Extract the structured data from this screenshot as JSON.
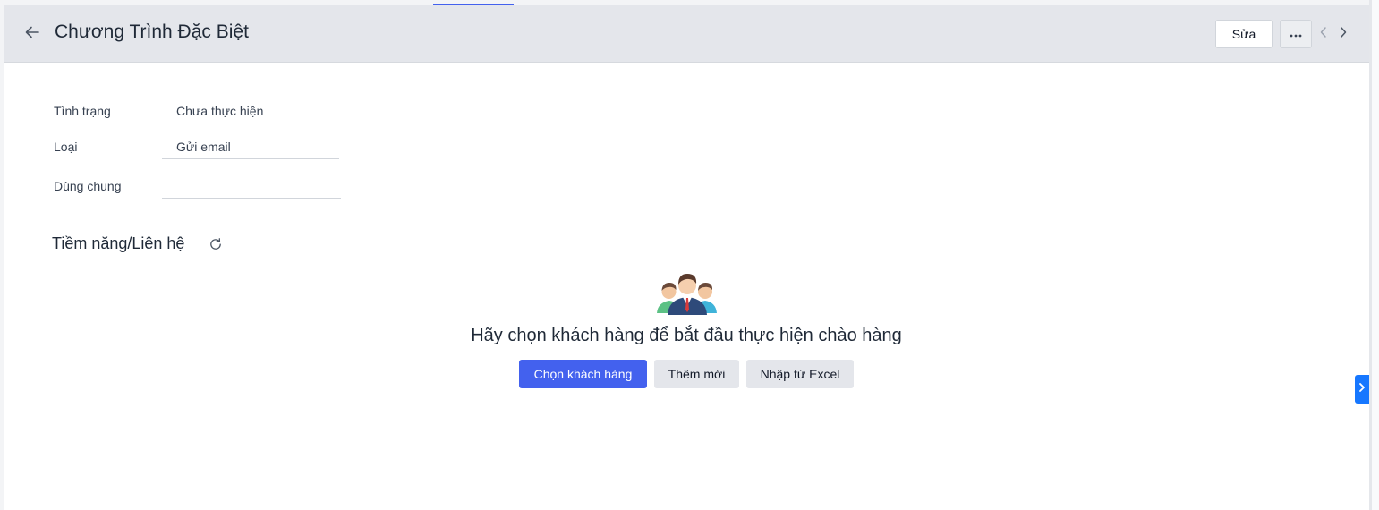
{
  "header": {
    "title": "Chương Trình Đặc Biệt",
    "edit_label": "Sửa",
    "back_icon": "arrow-left-icon",
    "more_icon": "ellipsis-icon",
    "prev_icon": "chevron-left-icon",
    "next_icon": "chevron-right-icon"
  },
  "fields": [
    {
      "label": "Tình trạng",
      "value": "Chưa thực hiện"
    },
    {
      "label": "Loại",
      "value": "Gửi email"
    },
    {
      "label": "Dùng chung",
      "value": ""
    }
  ],
  "section": {
    "title": "Tiềm năng/Liên hệ",
    "refresh_icon": "refresh-icon"
  },
  "empty_state": {
    "illustration": "people-group-icon",
    "message": "Hãy chọn khách hàng để bắt đầu thực hiện chào hàng",
    "buttons": {
      "primary": "Chọn khách hàng",
      "add_new": "Thêm mới",
      "import_excel": "Nhập từ Excel"
    }
  },
  "side_panel": {
    "toggle_icon": "chevron-right-icon"
  },
  "colors": {
    "accent": "#4361ee",
    "header_bg": "#e4e6eb",
    "side_toggle": "#1677ff"
  }
}
